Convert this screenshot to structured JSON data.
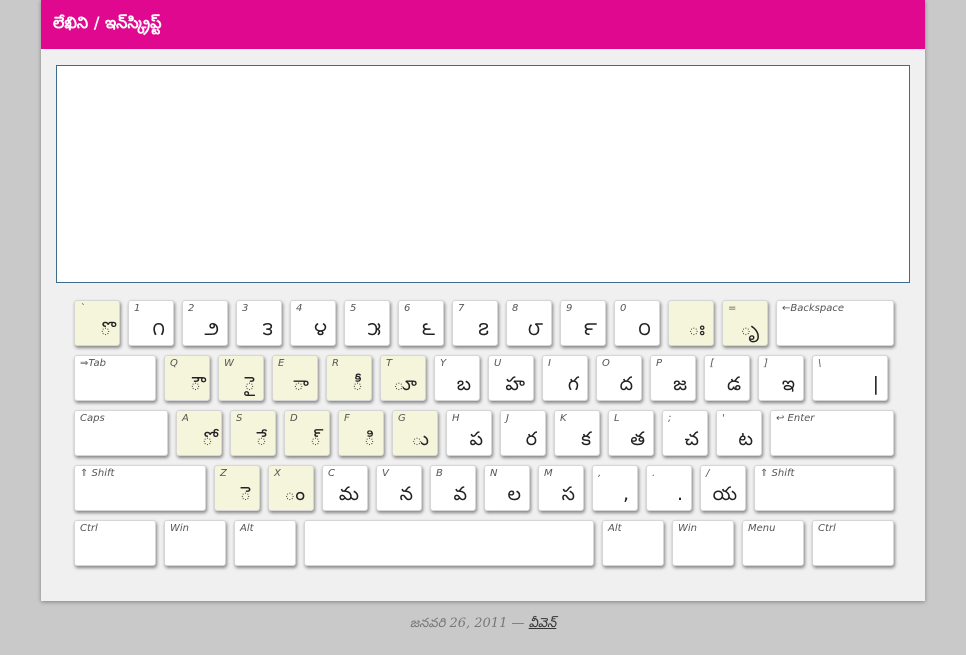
{
  "header": {
    "title": "లేఖిని / ఇన్‌స్క్రిప్ట్"
  },
  "editor": {
    "value": "",
    "placeholder": ""
  },
  "keyboard": {
    "rows": [
      {
        "keys": [
          {
            "label": "`",
            "char": "ొ",
            "vowel": true
          },
          {
            "label": "1",
            "char": "౧"
          },
          {
            "label": "2",
            "char": "౨"
          },
          {
            "label": "3",
            "char": "౩"
          },
          {
            "label": "4",
            "char": "౪"
          },
          {
            "label": "5",
            "char": "౫"
          },
          {
            "label": "6",
            "char": "౬"
          },
          {
            "label": "7",
            "char": "౭"
          },
          {
            "label": "8",
            "char": "౮"
          },
          {
            "label": "9",
            "char": "౯"
          },
          {
            "label": "0",
            "char": "౦"
          },
          {
            "label": "",
            "char": "ః",
            "vowel": true
          },
          {
            "label": "=",
            "char": "ృ",
            "vowel": true
          },
          {
            "label": "←Backspace",
            "char": ""
          }
        ]
      },
      {
        "keys": [
          {
            "label": "⇒Tab",
            "char": ""
          },
          {
            "label": "Q",
            "char": "ౌ",
            "vowel": true
          },
          {
            "label": "W",
            "char": "ై",
            "vowel": true
          },
          {
            "label": "E",
            "char": "ా",
            "vowel": true
          },
          {
            "label": "R",
            "char": "ీ",
            "vowel": true
          },
          {
            "label": "T",
            "char": "ూ",
            "vowel": true
          },
          {
            "label": "Y",
            "char": "బ"
          },
          {
            "label": "U",
            "char": "హ"
          },
          {
            "label": "I",
            "char": "గ"
          },
          {
            "label": "O",
            "char": "ద"
          },
          {
            "label": "P",
            "char": "జ"
          },
          {
            "label": "[",
            "char": "డ"
          },
          {
            "label": "]",
            "char": "ఇ"
          },
          {
            "label": "\\",
            "char": "|"
          }
        ]
      },
      {
        "keys": [
          {
            "label": "Caps",
            "char": ""
          },
          {
            "label": "A",
            "char": "ో",
            "vowel": true
          },
          {
            "label": "S",
            "char": "ే",
            "vowel": true
          },
          {
            "label": "D",
            "char": "్",
            "vowel": true
          },
          {
            "label": "F",
            "char": "ి",
            "vowel": true
          },
          {
            "label": "G",
            "char": "ు",
            "vowel": true
          },
          {
            "label": "H",
            "char": "ప"
          },
          {
            "label": "J",
            "char": "ర"
          },
          {
            "label": "K",
            "char": "క"
          },
          {
            "label": "L",
            "char": "త"
          },
          {
            "label": ";",
            "char": "చ"
          },
          {
            "label": "'",
            "char": "ట"
          },
          {
            "label": "↩ Enter",
            "char": ""
          }
        ]
      },
      {
        "keys": [
          {
            "label": "⇑ Shift",
            "char": ""
          },
          {
            "label": "Z",
            "char": "ె",
            "vowel": true
          },
          {
            "label": "X",
            "char": "ం",
            "vowel": true
          },
          {
            "label": "C",
            "char": "మ"
          },
          {
            "label": "V",
            "char": "న"
          },
          {
            "label": "B",
            "char": "వ"
          },
          {
            "label": "N",
            "char": "ల"
          },
          {
            "label": "M",
            "char": "స"
          },
          {
            "label": ",",
            "char": ","
          },
          {
            "label": ".",
            "char": "."
          },
          {
            "label": "/",
            "char": "య"
          },
          {
            "label": "⇑ Shift",
            "char": ""
          }
        ]
      },
      {
        "keys": [
          {
            "label": "Ctrl",
            "char": ""
          },
          {
            "label": "Win",
            "char": ""
          },
          {
            "label": "Alt",
            "char": ""
          },
          {
            "label": "",
            "char": ""
          },
          {
            "label": "Alt",
            "char": ""
          },
          {
            "label": "Win",
            "char": ""
          },
          {
            "label": "Menu",
            "char": ""
          },
          {
            "label": "Ctrl",
            "char": ""
          }
        ]
      }
    ]
  },
  "footer": {
    "date": "జనవరి 26, 2011",
    "separator": " — ",
    "author": "వీవెన్"
  },
  "colors": {
    "header": "#e0088e",
    "vowel_key": "#f5f5dc",
    "editor_border": "#3f6c8c"
  }
}
